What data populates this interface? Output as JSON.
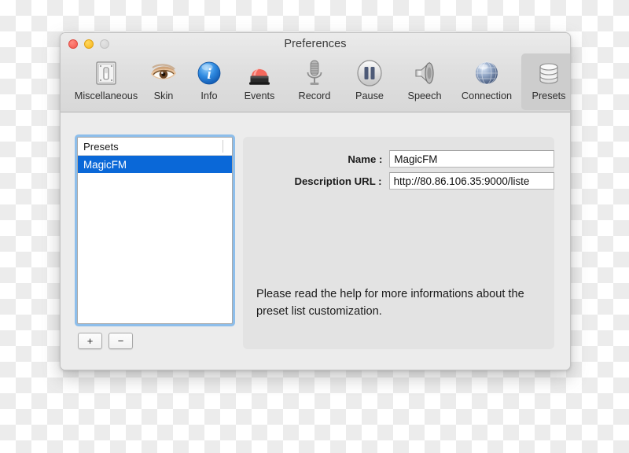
{
  "window": {
    "title": "Preferences",
    "traffic_lights": [
      {
        "name": "close",
        "color": "#f4564c"
      },
      {
        "name": "minimize",
        "color": "#f7b519"
      },
      {
        "name": "zoom",
        "color": "#d2d2d2"
      }
    ]
  },
  "toolbar": {
    "items": [
      {
        "label": "Miscellaneous",
        "icon": "light-switch-icon",
        "selected": false
      },
      {
        "label": "Skin",
        "icon": "eye-icon",
        "selected": false
      },
      {
        "label": "Info",
        "icon": "info-icon",
        "selected": false
      },
      {
        "label": "Events",
        "icon": "siren-light-icon",
        "selected": false
      },
      {
        "label": "Record",
        "icon": "microphone-icon",
        "selected": false
      },
      {
        "label": "Pause",
        "icon": "pause-icon",
        "selected": false
      },
      {
        "label": "Speech",
        "icon": "speaker-icon",
        "selected": false
      },
      {
        "label": "Connection",
        "icon": "globe-icon",
        "selected": false
      },
      {
        "label": "Presets",
        "icon": "database-icon",
        "selected": true
      }
    ],
    "selected_label": "Presets"
  },
  "presets_list": {
    "header": "Presets",
    "rows": [
      {
        "label": "MagicFM",
        "selected": true
      }
    ],
    "selection_color": "#0a68d8",
    "focus_ring_color": "#6eafeb"
  },
  "list_buttons": {
    "add_label": "+",
    "remove_label": "−"
  },
  "detail": {
    "fields": [
      {
        "label": "Name :",
        "value": "MagicFM",
        "placeholder": ""
      },
      {
        "label": "Description URL  :",
        "value": "http://80.86.106.35:9000/liste",
        "placeholder": ""
      }
    ],
    "help_text": "Please read the help for more informations about the preset list customization."
  }
}
